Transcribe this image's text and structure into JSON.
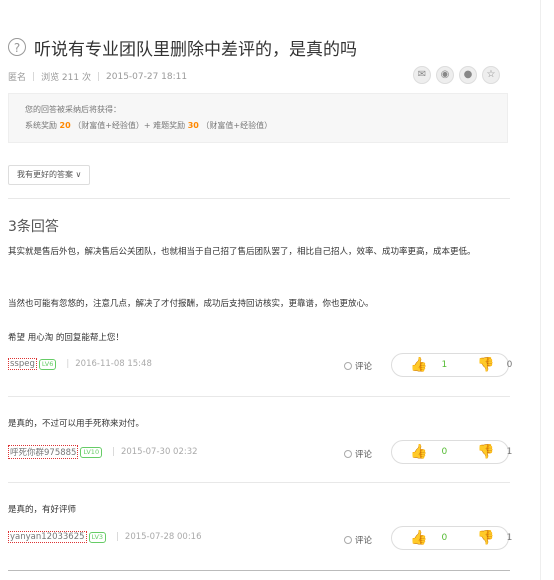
{
  "question": {
    "title": "听说有专业团队里删除中差评的，是真的吗",
    "author": "匿名",
    "views": "浏览 211 次",
    "date": "2015-07-27 18:11"
  },
  "reward": {
    "line1": "您的回答被采纳后将获得：",
    "line2_prefix": "系统奖励",
    "system_points": "20",
    "line2_mid": "（财富值+经验值）+ 难题奖励",
    "extra_points": "30",
    "line2_suffix": "（财富值+经验值）",
    "accent": "#ff8800"
  },
  "better_answer_button": "我有更好的答案 ∨",
  "answers_count": "3条回答",
  "answers": [
    {
      "paragraphs": [
        "其实就是售后外包，解决售后公关团队，也就相当于自己招了售后团队罢了，相比自己招人，效率、成功率更高，成本更低。",
        "当然也可能有忽悠的，注意几点，解决了才付报酬，成功后支持回访核实，更靠谱，你也更放心。",
        "希望 用心淘 的回复能帮上您！"
      ],
      "user": "sspeg",
      "level": "LV6",
      "date": "2016-11-08 15:48",
      "comment": "评论",
      "up": "1",
      "down": "0"
    },
    {
      "paragraphs": [
        "是真的，不过可以用手死称来对付。"
      ],
      "user": "呼死你群975885",
      "level": "LV10",
      "date": "2015-07-30 02:32",
      "comment": "评论",
      "up": "0",
      "down": "1"
    },
    {
      "paragraphs": [
        "是真的，有好评师"
      ],
      "user": "yanyan12033625",
      "level": "LV3",
      "date": "2015-07-28 00:16",
      "comment": "评论",
      "up": "0",
      "down": "1"
    }
  ]
}
